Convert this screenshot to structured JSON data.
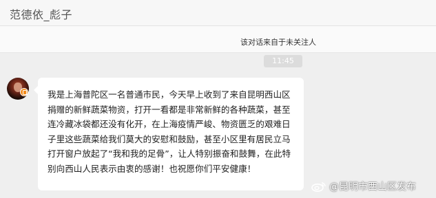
{
  "header": {
    "title": "范德依_彪子"
  },
  "notice": {
    "text": "该对话来自于未关注人"
  },
  "message": {
    "time": "11:45",
    "text": "我是上海普陀区一名普通市民，今天早上收到了来自昆明西山区捐赠的新鲜蔬菜物资，打开一看都是非常新鲜的各种蔬菜，甚至连冷藏冰袋都还没有化开，在上海疫情严峻、物资匮乏的艰难日子里这些蔬菜给我们莫大的安慰和鼓励，甚至小区里有居民立马打开窗户放起了“我和我的足骨”，让人特别振奋和鼓舞，在此特别向西山人民表示由衷的感谢！也祝愿你们平安健康！"
  },
  "watermark": {
    "text": "@昆明市西山区发布",
    "icon": "weibo-logo-icon"
  },
  "colors": {
    "background": "#efefef",
    "bubble": "#ffffff",
    "badge": "#f28a1b"
  }
}
